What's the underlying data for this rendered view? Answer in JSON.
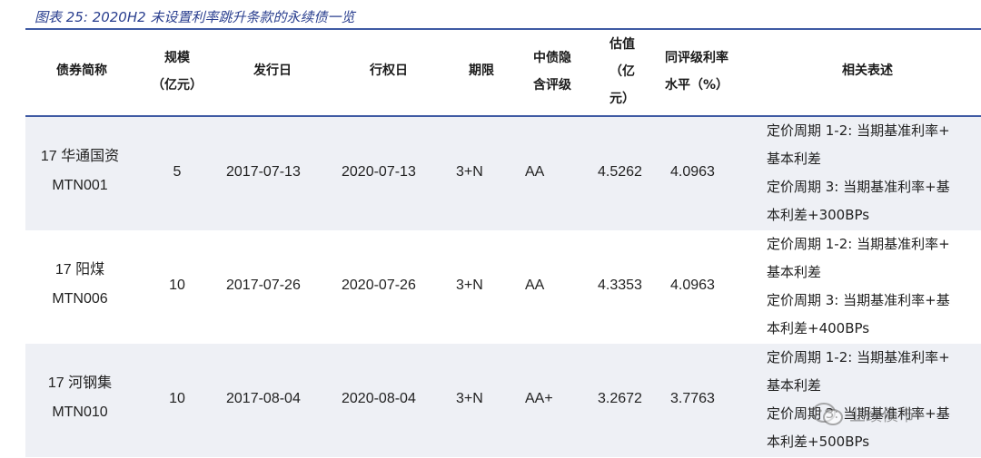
{
  "caption": "图表 25:  2020H2 未设置利率跳升条款的永续债一览",
  "headers": {
    "name": "债券简称",
    "scale_1": "规模",
    "scale_2": "（亿元）",
    "issue_date": "发行日",
    "exercise_date": "行权日",
    "term": "期限",
    "rating_1": "中债隐",
    "rating_2": "含评级",
    "val_1": "估值",
    "val_2": "（亿",
    "val_3": "元）",
    "rate_1": "同评级利率",
    "rate_2": "水平（%）",
    "desc": "相关表述"
  },
  "rows": [
    {
      "name_1": "17 华通国资",
      "name_2": "MTN001",
      "scale": "5",
      "issue_date": "2017-07-13",
      "exercise_date": "2020-07-13",
      "term": "3+N",
      "rating": "AA",
      "valuation": "4.5262",
      "rate": "4.0963",
      "desc": [
        "定价周期 1-2:  当期基准利率+",
        "基本利差",
        "定价周期 3:  当期基准利率+基",
        "本利差+300BPs"
      ]
    },
    {
      "name_1": "17 阳煤",
      "name_2": "MTN006",
      "scale": "10",
      "issue_date": "2017-07-26",
      "exercise_date": "2020-07-26",
      "term": "3+N",
      "rating": "AA",
      "valuation": "4.3353",
      "rate": "4.0963",
      "desc": [
        "定价周期 1-2:  当期基准利率+",
        "基本利差",
        "定价周期 3:  当期基准利率+基",
        "本利差+400BPs"
      ]
    },
    {
      "name_1": "17 河钢集",
      "name_2": "MTN010",
      "scale": "10",
      "issue_date": "2017-08-04",
      "exercise_date": "2020-08-04",
      "term": "3+N",
      "rating": "AA+",
      "valuation": "3.2672",
      "rate": "3.7763",
      "desc": [
        "定价周期 1-2:  当期基准利率+",
        "基本利差",
        "定价周期 3:  当期基准利率+基",
        "本利差+500BPs"
      ]
    }
  ],
  "watermark": "业绩债市",
  "icons": {
    "watermark_icon": "wechat-icon"
  }
}
